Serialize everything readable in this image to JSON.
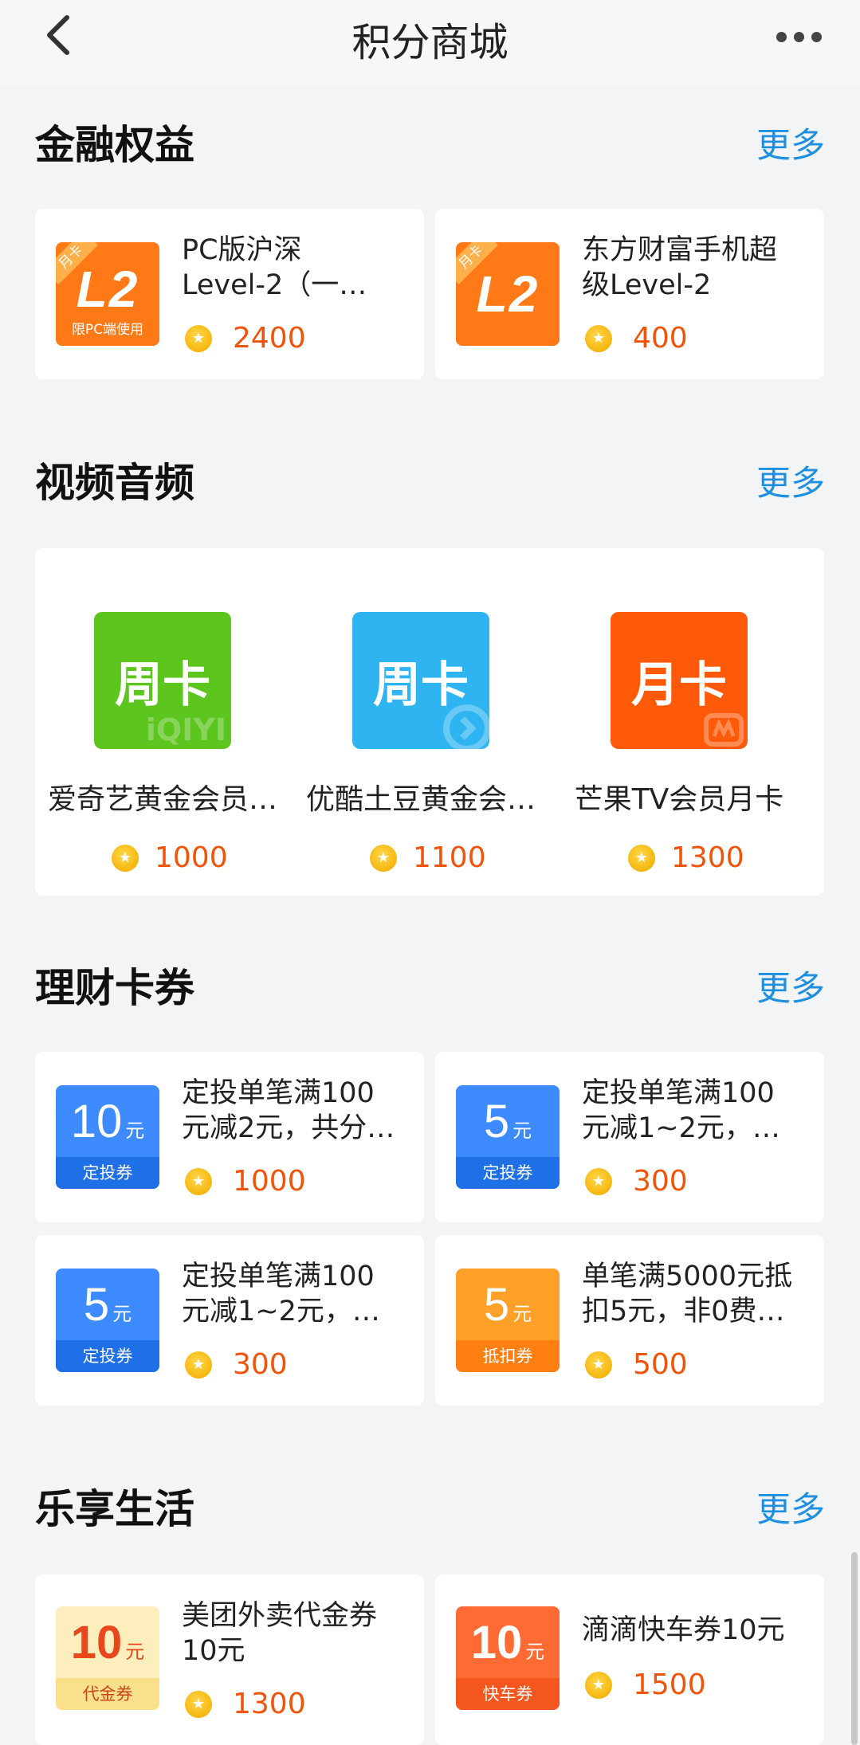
{
  "header": {
    "title": "积分商城",
    "back_icon": "chevron-left-icon",
    "more_icon": "more-dots-icon"
  },
  "sections": [
    {
      "title": "金融权益",
      "more": "更多",
      "items": [
        {
          "thumb_corner": "月卡",
          "thumb_big": "L2",
          "thumb_small": "限PC端使用",
          "name_line1": "PC版沪深",
          "name_line2": "Level-2（一…",
          "price": "2400"
        },
        {
          "thumb_corner": "月卡",
          "thumb_big": "L2",
          "thumb_small": "",
          "name_line1": "东方财富手机超",
          "name_line2": "级Level-2",
          "price": "400"
        }
      ]
    },
    {
      "title": "视频音频",
      "more": "更多",
      "items": [
        {
          "thumb_text": "周卡",
          "thumb_watermark": "iQIYI",
          "name": "爱奇艺黄金会员…",
          "price": "1000"
        },
        {
          "thumb_text": "周卡",
          "thumb_watermark": "",
          "name": "优酷土豆黄金会…",
          "price": "1100"
        },
        {
          "thumb_text": "月卡",
          "thumb_watermark": "",
          "name": "芒果TV会员月卡",
          "price": "1300"
        }
      ]
    },
    {
      "title": "理财卡券",
      "more": "更多",
      "items": [
        {
          "amount": "10",
          "unit": "元",
          "band": "定投券",
          "name_line1": "定投单笔满100",
          "name_line2": "元减2元，共分…",
          "price": "1000"
        },
        {
          "amount": "5",
          "unit": "元",
          "band": "定投券",
          "name_line1": "定投单笔满100",
          "name_line2": "元减1~2元，…",
          "price": "300"
        },
        {
          "amount": "5",
          "unit": "元",
          "band": "定投券",
          "name_line1": "定投单笔满100",
          "name_line2": "元减1~2元，…",
          "price": "300"
        },
        {
          "amount": "5",
          "unit": "元",
          "band": "抵扣券",
          "name_line1": "单笔满5000元抵",
          "name_line2": "扣5元，非0费…",
          "price": "500"
        }
      ]
    },
    {
      "title": "乐享生活",
      "more": "更多",
      "items": [
        {
          "amount": "10",
          "unit": "元",
          "band": "代金券",
          "name_line1": "美团外卖代金券",
          "name_line2": "10元",
          "price": "1300"
        },
        {
          "amount": "10",
          "unit": "元",
          "band": "快车券",
          "name_line1": "滴滴快车券10元",
          "name_line2": "",
          "price": "1500"
        }
      ]
    }
  ],
  "colors": {
    "accent_link": "#1f8fe0",
    "price": "#f0540a",
    "iqiyi_green": "#5cc51e",
    "youku_blue": "#2fb4f2",
    "mango_orange": "#ff5a0a"
  }
}
